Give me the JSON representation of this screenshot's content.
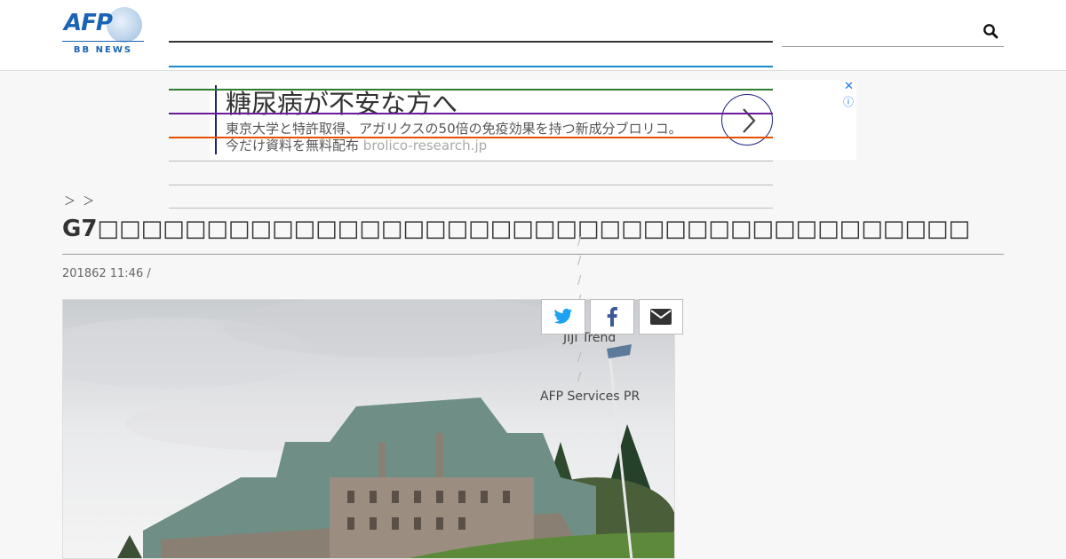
{
  "header": {
    "logo_text": "AFP",
    "logo_sub": "BB NEWS",
    "search_icon": "search-icon"
  },
  "ad": {
    "headline": "糖尿病が不安な方へ",
    "body_line1": "東京大学と特許取得、アガリクスの50倍の免疫効果を持つ新成分ブロリコ。",
    "body_line2": "今だけ資料を無料配布",
    "domain": "brolico-research.jp",
    "close_glyph": "✕",
    "info_glyph": "ⓘ",
    "arrow_glyph": "›"
  },
  "article": {
    "breadcrumb": "＞ ＞",
    "title": "G7□□□□□□□□□□□□□□□□□□□□□□□□□□□□□□□□□□□□□□□□",
    "date": "201862 11:46 /"
  },
  "sidebar": {
    "slash": "/",
    "link1": "JIJI Trend",
    "link2": "AFP Services PR"
  },
  "share": {
    "twitter": "twitter-icon",
    "facebook": "facebook-icon",
    "email": "email-icon"
  },
  "colors": {
    "brand": "#1b63b5",
    "rule_dark": "#333333",
    "rule_blue": "#1a8ac9",
    "rule_green": "#2e7d32",
    "rule_purple": "#6a1b9a",
    "rule_orange": "#e65100",
    "ad_accent": "#1a237e"
  }
}
